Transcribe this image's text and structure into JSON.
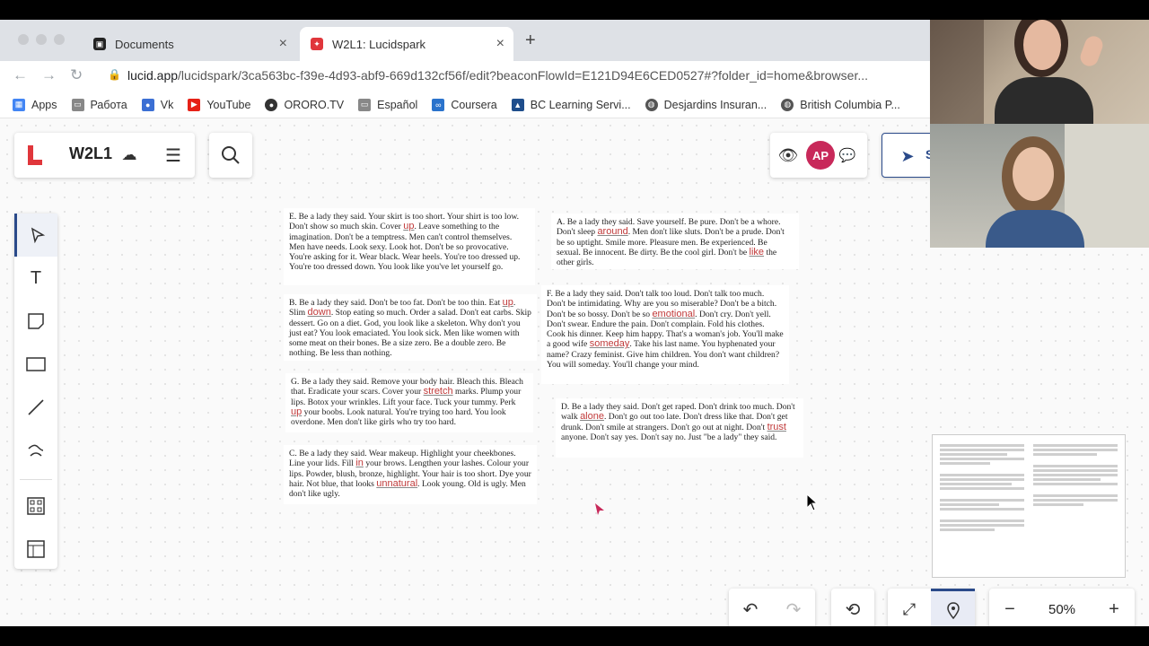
{
  "browser": {
    "tabs": [
      {
        "label": "Documents",
        "active": false
      },
      {
        "label": "W2L1: Lucidspark",
        "active": true
      }
    ],
    "url_domain": "lucid.app",
    "url_path": "/lucidspark/3ca563bc-f39e-4d93-abf9-669d132cf56f/edit?beaconFlowId=E121D94E6CED0527#?folder_id=home&browser...",
    "bookmarks": [
      "Apps",
      "Работа",
      "Vk",
      "YouTube",
      "ORORO.TV",
      "Español",
      "Coursera",
      "BC Learning Servi...",
      "Desjardins Insuran...",
      "British Columbia P..."
    ]
  },
  "app": {
    "title": "W2L1",
    "avatar_initials": "AP",
    "share_label": "S",
    "zoom": "50%",
    "accent": "#e0363b"
  },
  "icons": {
    "cloud": "cloud-icon",
    "menu": "hamburger-icon",
    "search": "search-icon",
    "eye": "eye-icon",
    "chat": "chat-icon",
    "send": "send-icon"
  },
  "stanzas": {
    "e": [
      {
        "t": "E. Be a lady they said. Your skirt is too short. Your shirt is too low. Don't show so much skin. Cover "
      },
      {
        "f": "up"
      },
      {
        "t": ". Leave something to the imagination. Don't be a temptress. Men can't control themselves. Men have needs. Look sexy. Look hot. Don't be so provocative. You're asking for it. Wear black. Wear heels. You're too dressed up. You're too dressed down. You look like you've let yourself go."
      }
    ],
    "a": [
      {
        "t": "A. Be a lady they said. Save yourself. Be pure. Don't be a whore. Don't sleep "
      },
      {
        "f": "around"
      },
      {
        "t": ". Men don't like sluts. Don't be a prude. Don't be so uptight. Smile more. Pleasure men. Be experienced. Be sexual. Be innocent. Be dirty. Be the cool girl. Don't be "
      },
      {
        "f": "like"
      },
      {
        "t": " the other girls."
      }
    ],
    "b": [
      {
        "t": "B. Be a lady they said. Don't be too fat. Don't be too thin. Eat "
      },
      {
        "f": "up"
      },
      {
        "t": ". Slim "
      },
      {
        "f": "down"
      },
      {
        "t": ". Stop eating so much. Order a salad. Don't eat carbs. Skip dessert. Go on a diet. God, you look like a skeleton. Why don't you just eat? You look emaciated. You look sick. Men like women with some meat on their bones. Be a size zero. Be a double zero. Be nothing. Be less than nothing."
      }
    ],
    "f": [
      {
        "t": "F. Be a lady they said. Don't talk too loud. Don't talk too much. Don't be intimidating. Why are you so miserable? Don't be a bitch. Don't be so bossy. Don't be so "
      },
      {
        "f": "emotional"
      },
      {
        "t": ". Don't cry. Don't yell. Don't swear. Endure the pain. Don't complain. Fold his clothes. Cook his dinner. Keep him happy. That's a woman's job. You'll make a good wife "
      },
      {
        "f": "someday"
      },
      {
        "t": ". Take his last name. You hyphenated your name? Crazy feminist. Give him children. You don't want children? You will someday. You'll change your mind."
      }
    ],
    "g": [
      {
        "t": "G. Be a lady they said. Remove your body hair. Bleach this. Bleach that. Eradicate your scars. Cover your "
      },
      {
        "f": "stretch"
      },
      {
        "t": " marks. Plump your lips. Botox your wrinkles. Lift your face. Tuck your tummy. Perk "
      },
      {
        "f": "up"
      },
      {
        "t": " your boobs. Look natural. You're trying too hard. You look overdone. Men don't like girls who try too hard."
      }
    ],
    "d": [
      {
        "t": "D. Be a lady they said. Don't get raped. Don't drink too much. Don't walk "
      },
      {
        "f": "alone"
      },
      {
        "t": ". Don't go out too late. Don't dress like that. Don't get drunk. Don't smile at strangers. Don't go out at night. Don't "
      },
      {
        "f": "trust"
      },
      {
        "t": " anyone. Don't say yes. Don't say no. Just \"be a lady\" they said."
      }
    ],
    "c": [
      {
        "t": "C. Be a lady they said. Wear makeup. Highlight your cheekbones. Line your lids. Fill "
      },
      {
        "f": "in"
      },
      {
        "t": " your brows. Lengthen your lashes. Colour your lips. Powder, blush, bronze, highlight. Your hair is too short. Dye your hair. Not blue, that looks "
      },
      {
        "f": "unnatural"
      },
      {
        "t": ". Look young. Old is ugly. Men don't like ugly."
      }
    ]
  }
}
